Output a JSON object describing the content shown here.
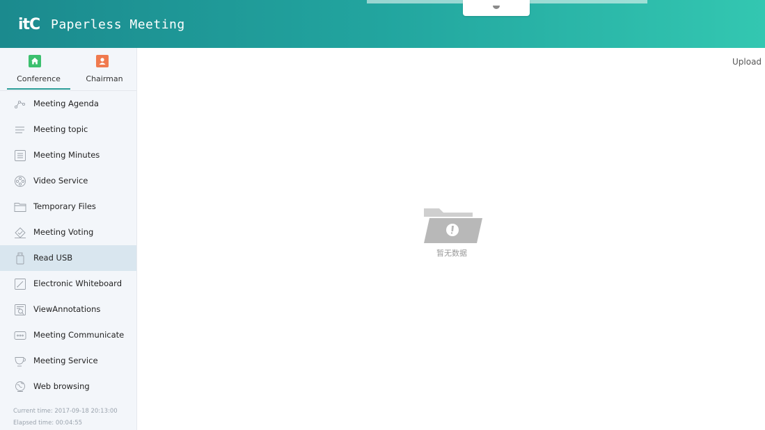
{
  "header": {
    "logo_text": "itC",
    "app_title": "Paperless Meeting"
  },
  "tabs": [
    {
      "label": "Conference",
      "icon": "home-icon",
      "color": "#3cc06e",
      "active": true
    },
    {
      "label": "Chairman",
      "icon": "user-icon",
      "color": "#f07a4e",
      "active": false
    }
  ],
  "menu": [
    {
      "label": "Meeting Agenda",
      "icon": "agenda-icon",
      "active": false
    },
    {
      "label": "Meeting topic",
      "icon": "topic-icon",
      "active": false
    },
    {
      "label": "Meeting Minutes",
      "icon": "minutes-icon",
      "active": false
    },
    {
      "label": "Video Service",
      "icon": "video-reel-icon",
      "active": false
    },
    {
      "label": "Temporary Files",
      "icon": "folder-icon",
      "active": false
    },
    {
      "label": "Meeting Voting",
      "icon": "voting-icon",
      "active": false
    },
    {
      "label": "Read USB",
      "icon": "usb-icon",
      "active": true
    },
    {
      "label": "Electronic Whiteboard",
      "icon": "whiteboard-icon",
      "active": false
    },
    {
      "label": "ViewAnnotations",
      "icon": "annotations-icon",
      "active": false
    },
    {
      "label": "Meeting Communicate",
      "icon": "chat-icon",
      "active": false
    },
    {
      "label": "Meeting Service",
      "icon": "tea-cup-icon",
      "active": false
    },
    {
      "label": "Web browsing",
      "icon": "globe-icon",
      "active": false
    }
  ],
  "footer": {
    "current_time": "Current time:  2017-09-18 20:13:00",
    "elapsed_time": "Elapsed time:  00:04:55"
  },
  "main": {
    "upload_label": "Upload",
    "empty_text": "暂无数据"
  },
  "colors": {
    "header_start": "#1b8a8e",
    "header_end": "#33c7b1",
    "accent": "#2a9d97",
    "active_row": "#d9e6ef"
  }
}
